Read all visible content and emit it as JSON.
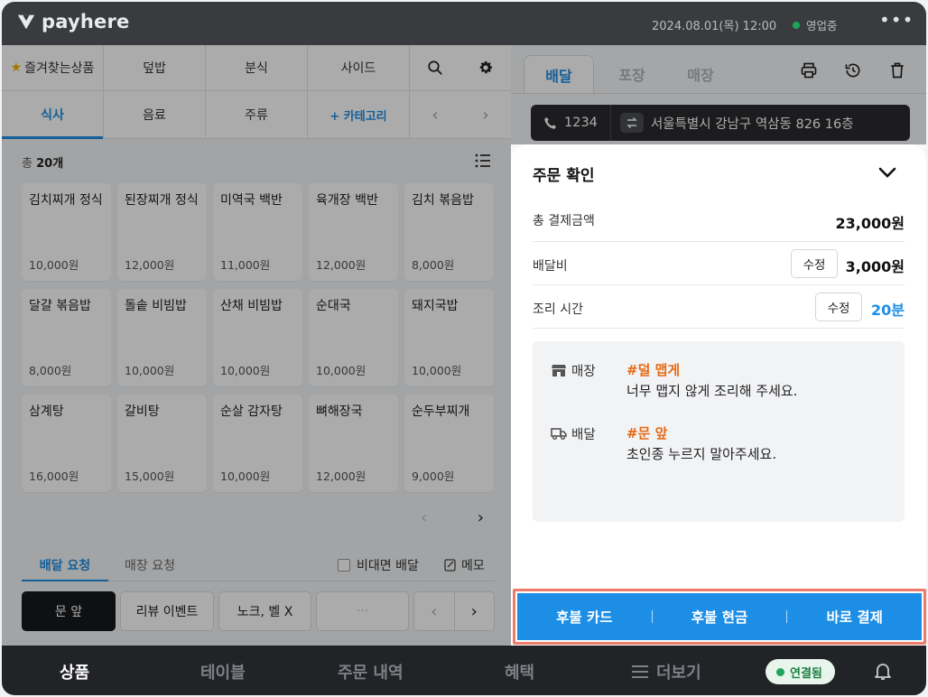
{
  "brand": {
    "logo_text": "payhere"
  },
  "topbar": {
    "datetime": "2024.08.01(목) 12:00",
    "status": "영업중",
    "status_color": "#1fa45a"
  },
  "categories": {
    "row1": [
      "즐겨찾는상품",
      "덮밥",
      "분식",
      "사이드"
    ],
    "row2": [
      "식사",
      "음료",
      "주류"
    ],
    "add_category": "+ 카테고리",
    "active": "식사"
  },
  "product_list": {
    "count_prefix": "총",
    "count": "20개",
    "items": [
      {
        "name": "김치찌개 정식",
        "price": "10,000원"
      },
      {
        "name": "된장찌개 정식",
        "price": "12,000원"
      },
      {
        "name": "미역국 백반",
        "price": "11,000원"
      },
      {
        "name": "육개장 백반",
        "price": "12,000원"
      },
      {
        "name": "김치 볶음밥",
        "price": "8,000원"
      },
      {
        "name": "달걀 볶음밥",
        "price": "8,000원"
      },
      {
        "name": "돌솥 비빔밥",
        "price": "10,000원"
      },
      {
        "name": "산채 비빔밥",
        "price": "10,000원"
      },
      {
        "name": "순대국",
        "price": "10,000원"
      },
      {
        "name": "돼지국밥",
        "price": "10,000원"
      },
      {
        "name": "삼계탕",
        "price": "16,000원"
      },
      {
        "name": "갈비탕",
        "price": "15,000원"
      },
      {
        "name": "순살 감자탕",
        "price": "10,000원"
      },
      {
        "name": "뼈해장국",
        "price": "12,000원"
      },
      {
        "name": "순두부찌개",
        "price": "9,000원"
      }
    ]
  },
  "requests": {
    "tabs": [
      "배달 요청",
      "매장 요청"
    ],
    "no_contact": "비대면 배달",
    "memo": "메모",
    "chips": [
      "문 앞",
      "리뷰 이벤트",
      "노크, 벨 X",
      "···"
    ]
  },
  "order_tabs": [
    "배달",
    "포장",
    "매장"
  ],
  "customer": {
    "phone": "1234",
    "address": "서울특별시 강남구 역삼동 826 16층"
  },
  "confirm": {
    "title": "주문 확인",
    "total_label": "총 결제금액",
    "total_value": "23,000원",
    "delivery_fee_label": "배달비",
    "delivery_fee_value": "3,000원",
    "cook_time_label": "조리 시간",
    "cook_time_value": "20분",
    "edit_label": "수정",
    "notes": [
      {
        "label": "매장",
        "tag": "#덜 맵게",
        "text": "너무 맵지 않게 조리해 주세요."
      },
      {
        "label": "배달",
        "tag": "#문 앞",
        "text": "초인종 누르지 말아주세요."
      }
    ]
  },
  "payment": {
    "deferred_card": "후불 카드",
    "deferred_cash": "후불 현금",
    "pay_now": "바로 결제",
    "color": "#1d8ee6"
  },
  "bottom_nav": {
    "items": [
      "상품",
      "테이블",
      "주문 내역",
      "혜택",
      "더보기"
    ],
    "connection": "연결됨"
  },
  "colors": {
    "accent": "#1d8ee6",
    "tag": "#e66a12",
    "dark": "#222327"
  }
}
